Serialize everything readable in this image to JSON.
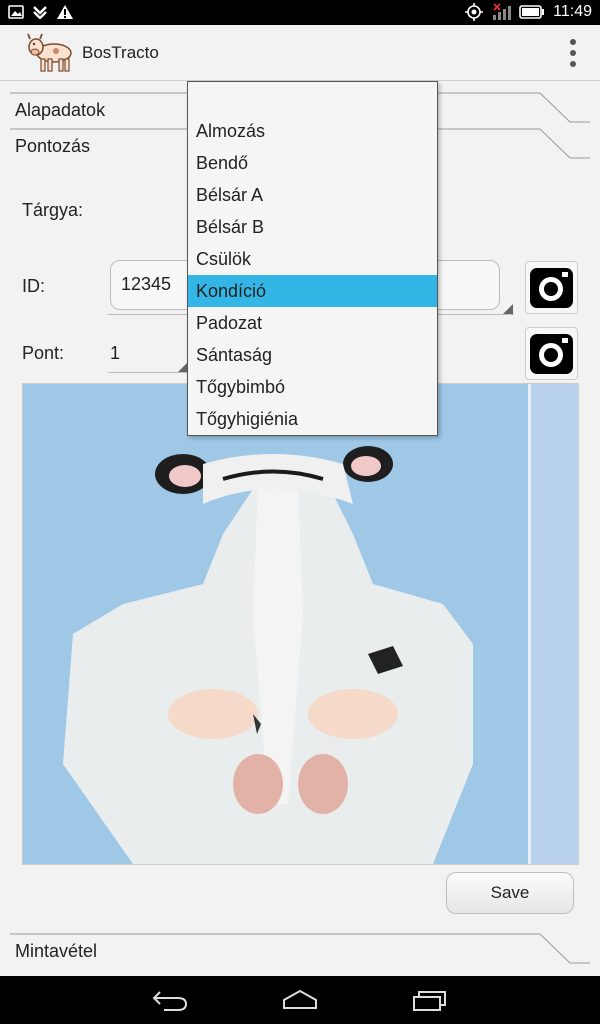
{
  "statusbar": {
    "time": "11:49",
    "left_icons": [
      "image-icon",
      "download-icon",
      "warning-icon"
    ],
    "right_icons": [
      "location-icon",
      "signal-off-icon",
      "battery-icon"
    ]
  },
  "app": {
    "title": "BosTracto",
    "logo_icon": "cow-icon",
    "menu_icon": "overflow-menu-icon"
  },
  "sections": {
    "alapadatok": "Alapadatok",
    "pontozas": "Pontozás",
    "mintavetel": "Mintavétel"
  },
  "form": {
    "targya_label": "Tárgya:",
    "id_label": "ID:",
    "id_value": "12345",
    "pont_label": "Pont:",
    "pont_value": "1",
    "camera_icon": "camera-icon",
    "save_label": "Save"
  },
  "dropdown": {
    "selected": "Kondíció",
    "items": [
      "Almozás",
      "Bendő",
      "Bélsár A",
      "Bélsár B",
      "Csülök",
      "Kondíció",
      "Padozat",
      "Sántaság",
      "Tőgybimbó",
      "Tőgyhigiénia"
    ]
  },
  "navbar": {
    "icons": [
      "back-icon",
      "home-icon",
      "recent-apps-icon"
    ]
  },
  "colors": {
    "selection": "#33b5e5",
    "photo_sky": "#9fc7e6"
  }
}
